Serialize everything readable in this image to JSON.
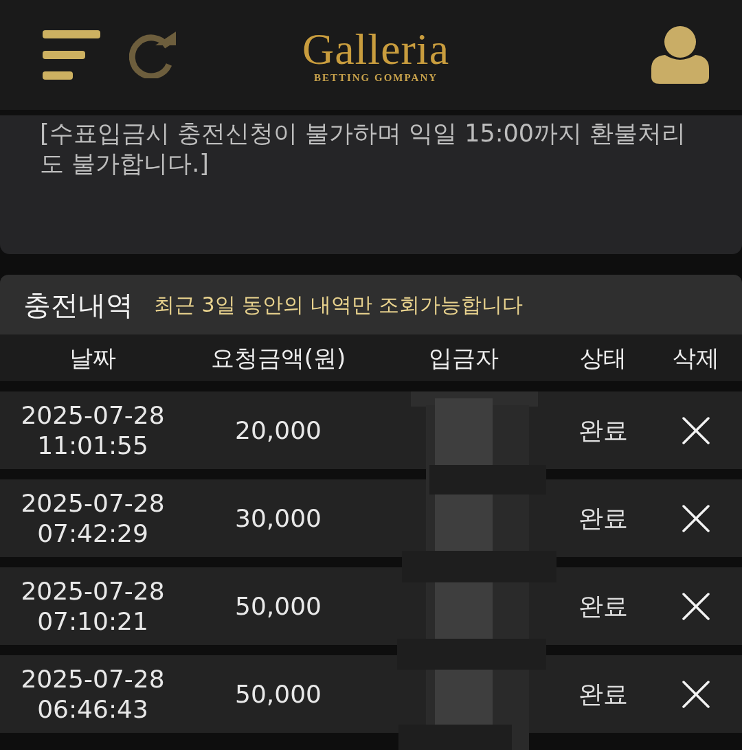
{
  "header": {
    "logo": {
      "title": "Galleria",
      "subtitle": "BETTING GOMPANY"
    }
  },
  "notice": {
    "text": "[수표입금시 충전신청이 불가하며 익일 15:00까지 환불처리도 불가합니다.]"
  },
  "history": {
    "title": "충전내역",
    "subtitle": "최근 3일 동안의 내역만 조회가능합니다",
    "depositor_redacted": true,
    "columns": [
      "날짜",
      "요청금액(원)",
      "입금자",
      "상태",
      "삭제"
    ],
    "rows": [
      {
        "date": "2025-07-28",
        "time": "11:01:55",
        "amount": "20,000",
        "status": "완료"
      },
      {
        "date": "2025-07-28",
        "time": "07:42:29",
        "amount": "30,000",
        "status": "완료"
      },
      {
        "date": "2025-07-28",
        "time": "07:10:21",
        "amount": "50,000",
        "status": "완료"
      },
      {
        "date": "2025-07-28",
        "time": "06:46:43",
        "amount": "50,000",
        "status": "완료"
      }
    ]
  }
}
